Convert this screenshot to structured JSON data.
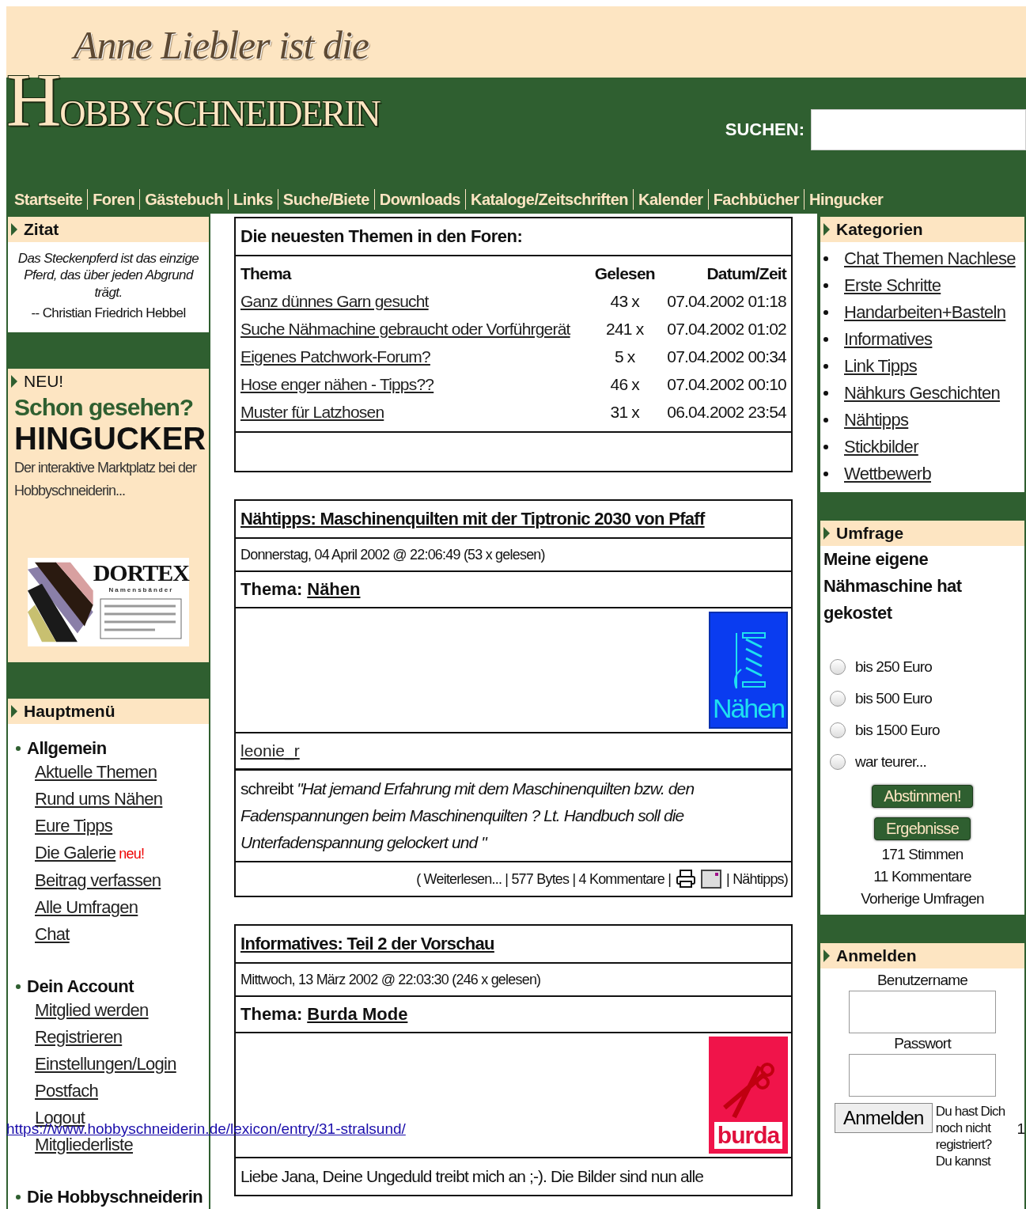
{
  "header": {
    "logo_subtitle": "Anne Liebler ist die",
    "logo_title": "HOBBYSCHNEIDERIN",
    "search": {
      "label": "SUCHEN:"
    }
  },
  "nav": [
    "Startseite",
    "Foren",
    "Gästebuch",
    "Links",
    "Suche/Biete",
    "Downloads",
    "Kataloge/Zeitschriften",
    "Kalender",
    "Fachbücher",
    "Hingucker"
  ],
  "left": {
    "quote_box": {
      "title": "Zitat",
      "quote": "Das Steckenpferd ist das einzige Pferd, das über jeden Abgrund trägt.",
      "author": "-- Christian Friedrich Hebbel"
    },
    "new_box": {
      "title": "NEU!",
      "ad_kicker": "Schon gesehen?",
      "ad_title": "HINGUCKER",
      "ad_text": "Der interaktive Marktplatz bei der Hobbyschneiderin...",
      "banner": {
        "brand": "DORTEX",
        "tagline": "Namensbänder"
      }
    },
    "main_menu": {
      "title": "Hauptmenü",
      "groups": [
        {
          "title": "Allgemein",
          "items": [
            {
              "label": "Aktuelle Themen"
            },
            {
              "label": "Rund ums Nähen"
            },
            {
              "label": "Eure Tipps"
            },
            {
              "label": "Die Galerie",
              "badge": "neu!"
            },
            {
              "label": "Beitrag verfassen"
            },
            {
              "label": "Alle Umfragen"
            },
            {
              "label": "Chat"
            }
          ]
        },
        {
          "title": "Dein Account",
          "items": [
            {
              "label": "Mitglied werden"
            },
            {
              "label": "Registrieren"
            },
            {
              "label": "Einstellungen/Login"
            },
            {
              "label": "Postfach"
            },
            {
              "label": "Logout"
            },
            {
              "label": "Mitgliederliste"
            }
          ]
        },
        {
          "title": "Die Hobbyschneiderin"
        }
      ]
    }
  },
  "center": {
    "forum": {
      "title": "Die neuesten Themen in den Foren:",
      "columns": [
        "Thema",
        "Gelesen",
        "Datum/Zeit"
      ],
      "rows": [
        {
          "topic": "Ganz dünnes Garn gesucht",
          "reads": "43 x",
          "date": "07.04.2002 01:18"
        },
        {
          "topic": "Suche Nähmachine gebraucht oder Vorführgerät",
          "reads": "241 x",
          "date": "07.04.2002 01:02"
        },
        {
          "topic": "Eigenes Patchwork-Forum?",
          "reads": "5 x",
          "date": "07.04.2002 00:34"
        },
        {
          "topic": "Hose enger nähen - Tipps??",
          "reads": "46 x",
          "date": "07.04.2002 00:10"
        },
        {
          "topic": "Muster für Latzhosen",
          "reads": "31 x",
          "date": "06.04.2002 23:54"
        }
      ]
    },
    "articles": [
      {
        "title": "Nähtipps: Maschinenquilten mit der Tiptronic 2030 von Pfaff",
        "meta": "Donnerstag, 04 April 2002 @ 22:06:49 (53 x gelesen)",
        "topic_label": "Thema:",
        "topic": "Nähen",
        "image": {
          "kind": "naehen",
          "label": "Nähen"
        },
        "author": "leonie_r",
        "text": "schreibt *\"Hat jemand Erfahrung mit dem Maschinenquilten bzw. den Fadenspannungen beim Maschinenquilten ? Lt. Handbuch soll die Unterfadenspannung gelockert und \"*",
        "footer": {
          "info": "( Weiterlesen... | 577 Bytes | 4 Kommentare |",
          "category": "| Nähtipps)"
        }
      },
      {
        "title": "Informatives: Teil 2 der Vorschau",
        "meta": "Mittwoch, 13 März 2002 @ 22:03:30 (246 x gelesen)",
        "topic_label": "Thema:",
        "topic": "Burda Mode",
        "image": {
          "kind": "burda",
          "label": "burda"
        },
        "text": "Liebe Jana, Deine Ungeduld treibt mich an ;-). Die Bilder sind nun alle"
      }
    ]
  },
  "right": {
    "categories": {
      "title": "Kategorien",
      "items": [
        "Chat Themen Nachlese",
        "Erste Schritte",
        "Handarbeiten+Basteln",
        "Informatives",
        "Link Tipps",
        "Nähkurs Geschichten",
        "Nähtipps",
        "Stickbilder",
        "Wettbewerb"
      ]
    },
    "poll": {
      "title": "Umfrage",
      "question": "Meine eigene Nähmaschine hat gekostet",
      "options": [
        {
          "label": "bis 250 Euro",
          "selected": false
        },
        {
          "label": "bis 500 Euro",
          "selected": false
        },
        {
          "label": "bis 1500 Euro",
          "selected": false
        },
        {
          "label": "war teurer...",
          "selected": false
        }
      ],
      "vote_button": "Abstimmen!",
      "results_button": "Ergebnisse",
      "stats": [
        "171 Stimmen",
        "11 Kommentare",
        "Vorherige Umfragen"
      ]
    },
    "login": {
      "title": "Anmelden",
      "username_label": "Benutzername",
      "password_label": "Passwort",
      "button": "Anmelden",
      "note": "Du hast Dich noch nicht registriert? Du kannst"
    }
  },
  "overlay": {
    "url": "https://www.hobbyschneiderin.de/lexicon/entry/31-stralsund/",
    "page_number": "1"
  }
}
